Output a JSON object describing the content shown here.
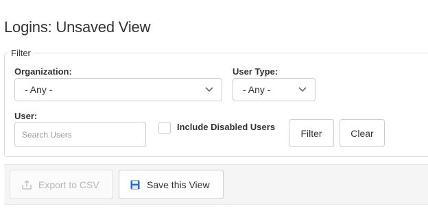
{
  "page": {
    "title": "Logins: Unsaved View"
  },
  "filter": {
    "legend": "Filter",
    "organization": {
      "label": "Organization:",
      "value": "- Any -"
    },
    "user_type": {
      "label": "User Type:",
      "value": "- Any -"
    },
    "user": {
      "label": "User:",
      "placeholder": "Search Users",
      "value": ""
    },
    "include_disabled": {
      "label": "Include Disabled Users",
      "checked": false
    },
    "filter_button": "Filter",
    "clear_button": "Clear"
  },
  "toolbar": {
    "export_button": {
      "label": "Export to CSV",
      "icon": "export-icon",
      "disabled": true
    },
    "save_button": {
      "label": "Save this View",
      "icon": "floppy-disk-icon",
      "disabled": false
    }
  },
  "colors": {
    "border": "#cccccc",
    "toolbar_bg": "#f5f5f5",
    "save_icon": "#2a6ebb",
    "disabled_text": "#b5b5b5"
  }
}
